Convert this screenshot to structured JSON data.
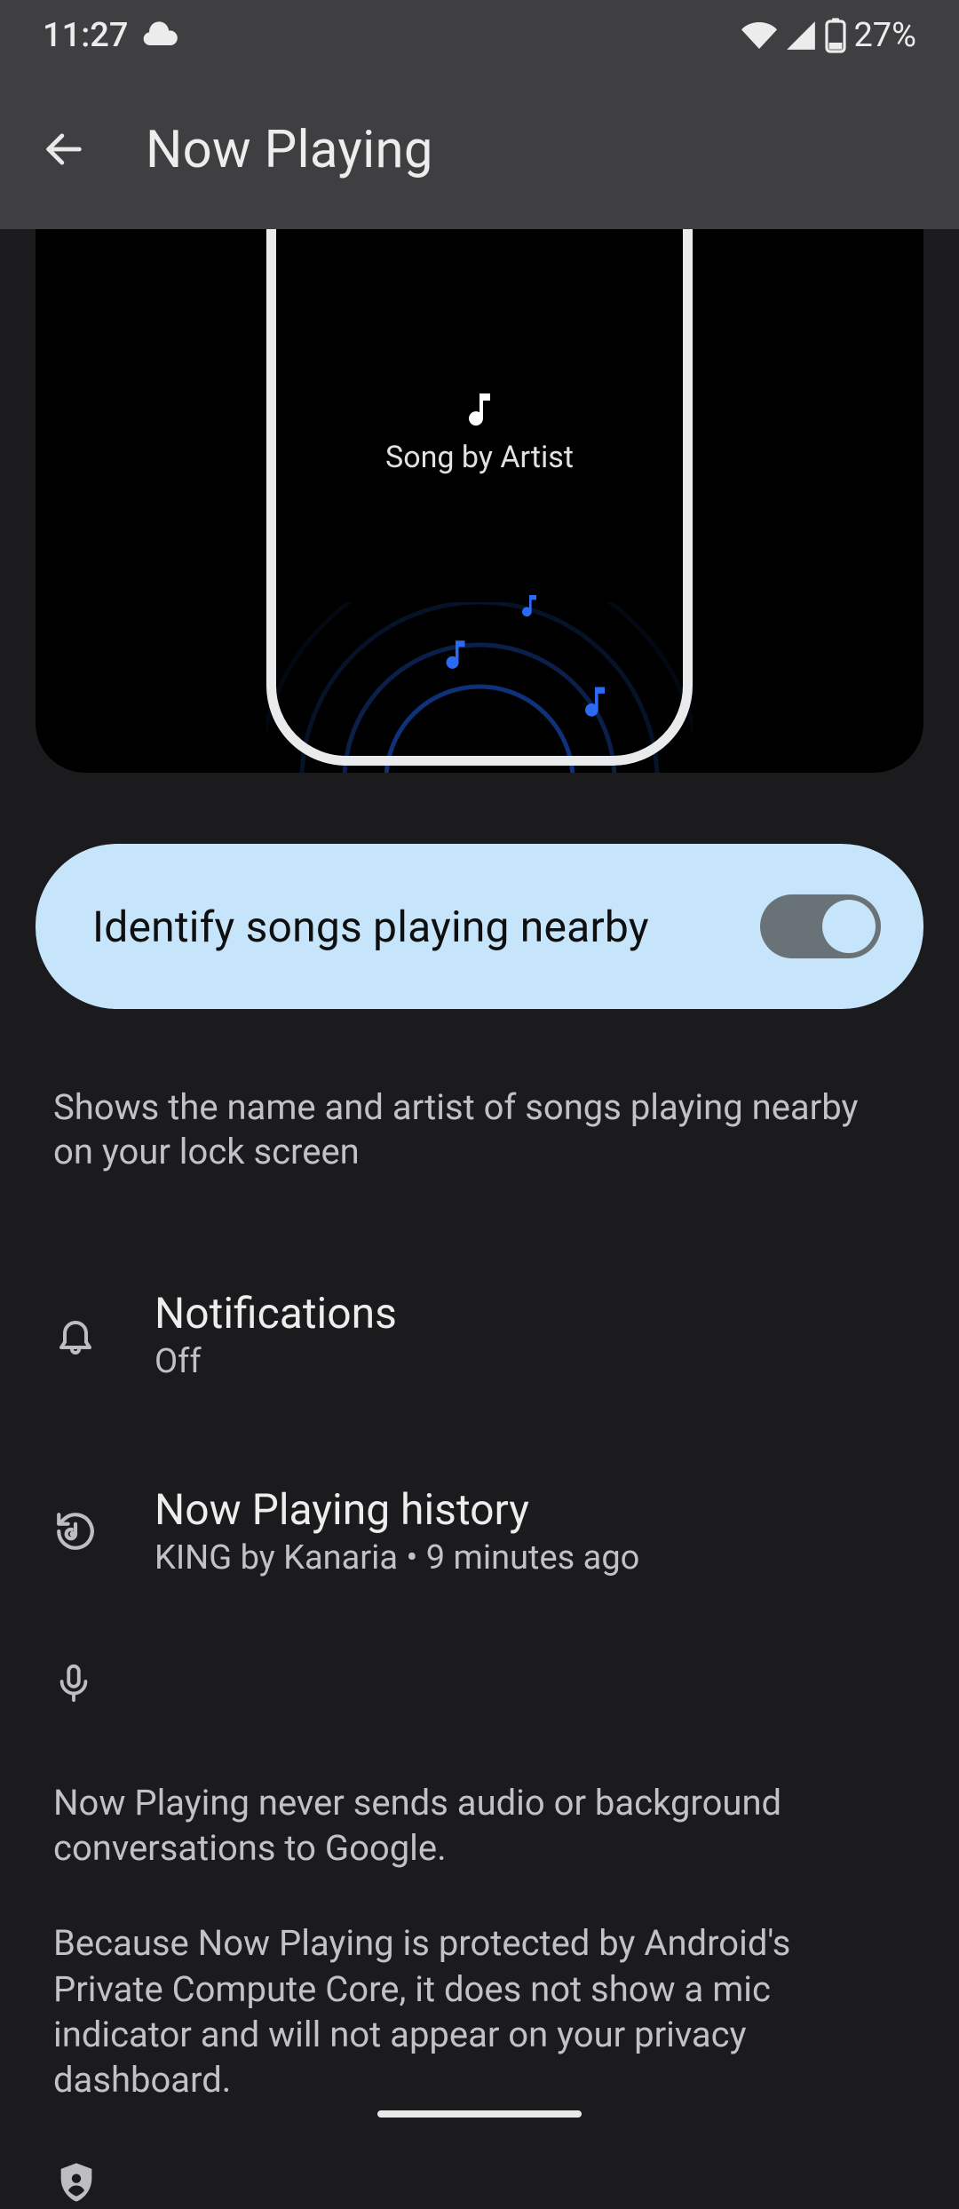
{
  "status_bar": {
    "time": "11:27",
    "battery_text": "27%"
  },
  "header": {
    "title": "Now Playing"
  },
  "hero": {
    "song_label": "Song by Artist"
  },
  "main_toggle": {
    "label": "Identify songs playing nearby",
    "enabled": true
  },
  "description": "Shows the name and artist of songs playing nearby on your lock screen",
  "settings": {
    "notifications": {
      "title": "Notifications",
      "value": "Off"
    },
    "history": {
      "title": "Now Playing history",
      "value": "KING by Kanaria • 9 minutes ago"
    }
  },
  "privacy": {
    "p1": "Now Playing never sends audio or background conversations to Google.",
    "p2": "Because Now Playing is protected by Android's Private Compute Core, it does not show a mic indicator and will not appear on your privacy dashboard."
  }
}
